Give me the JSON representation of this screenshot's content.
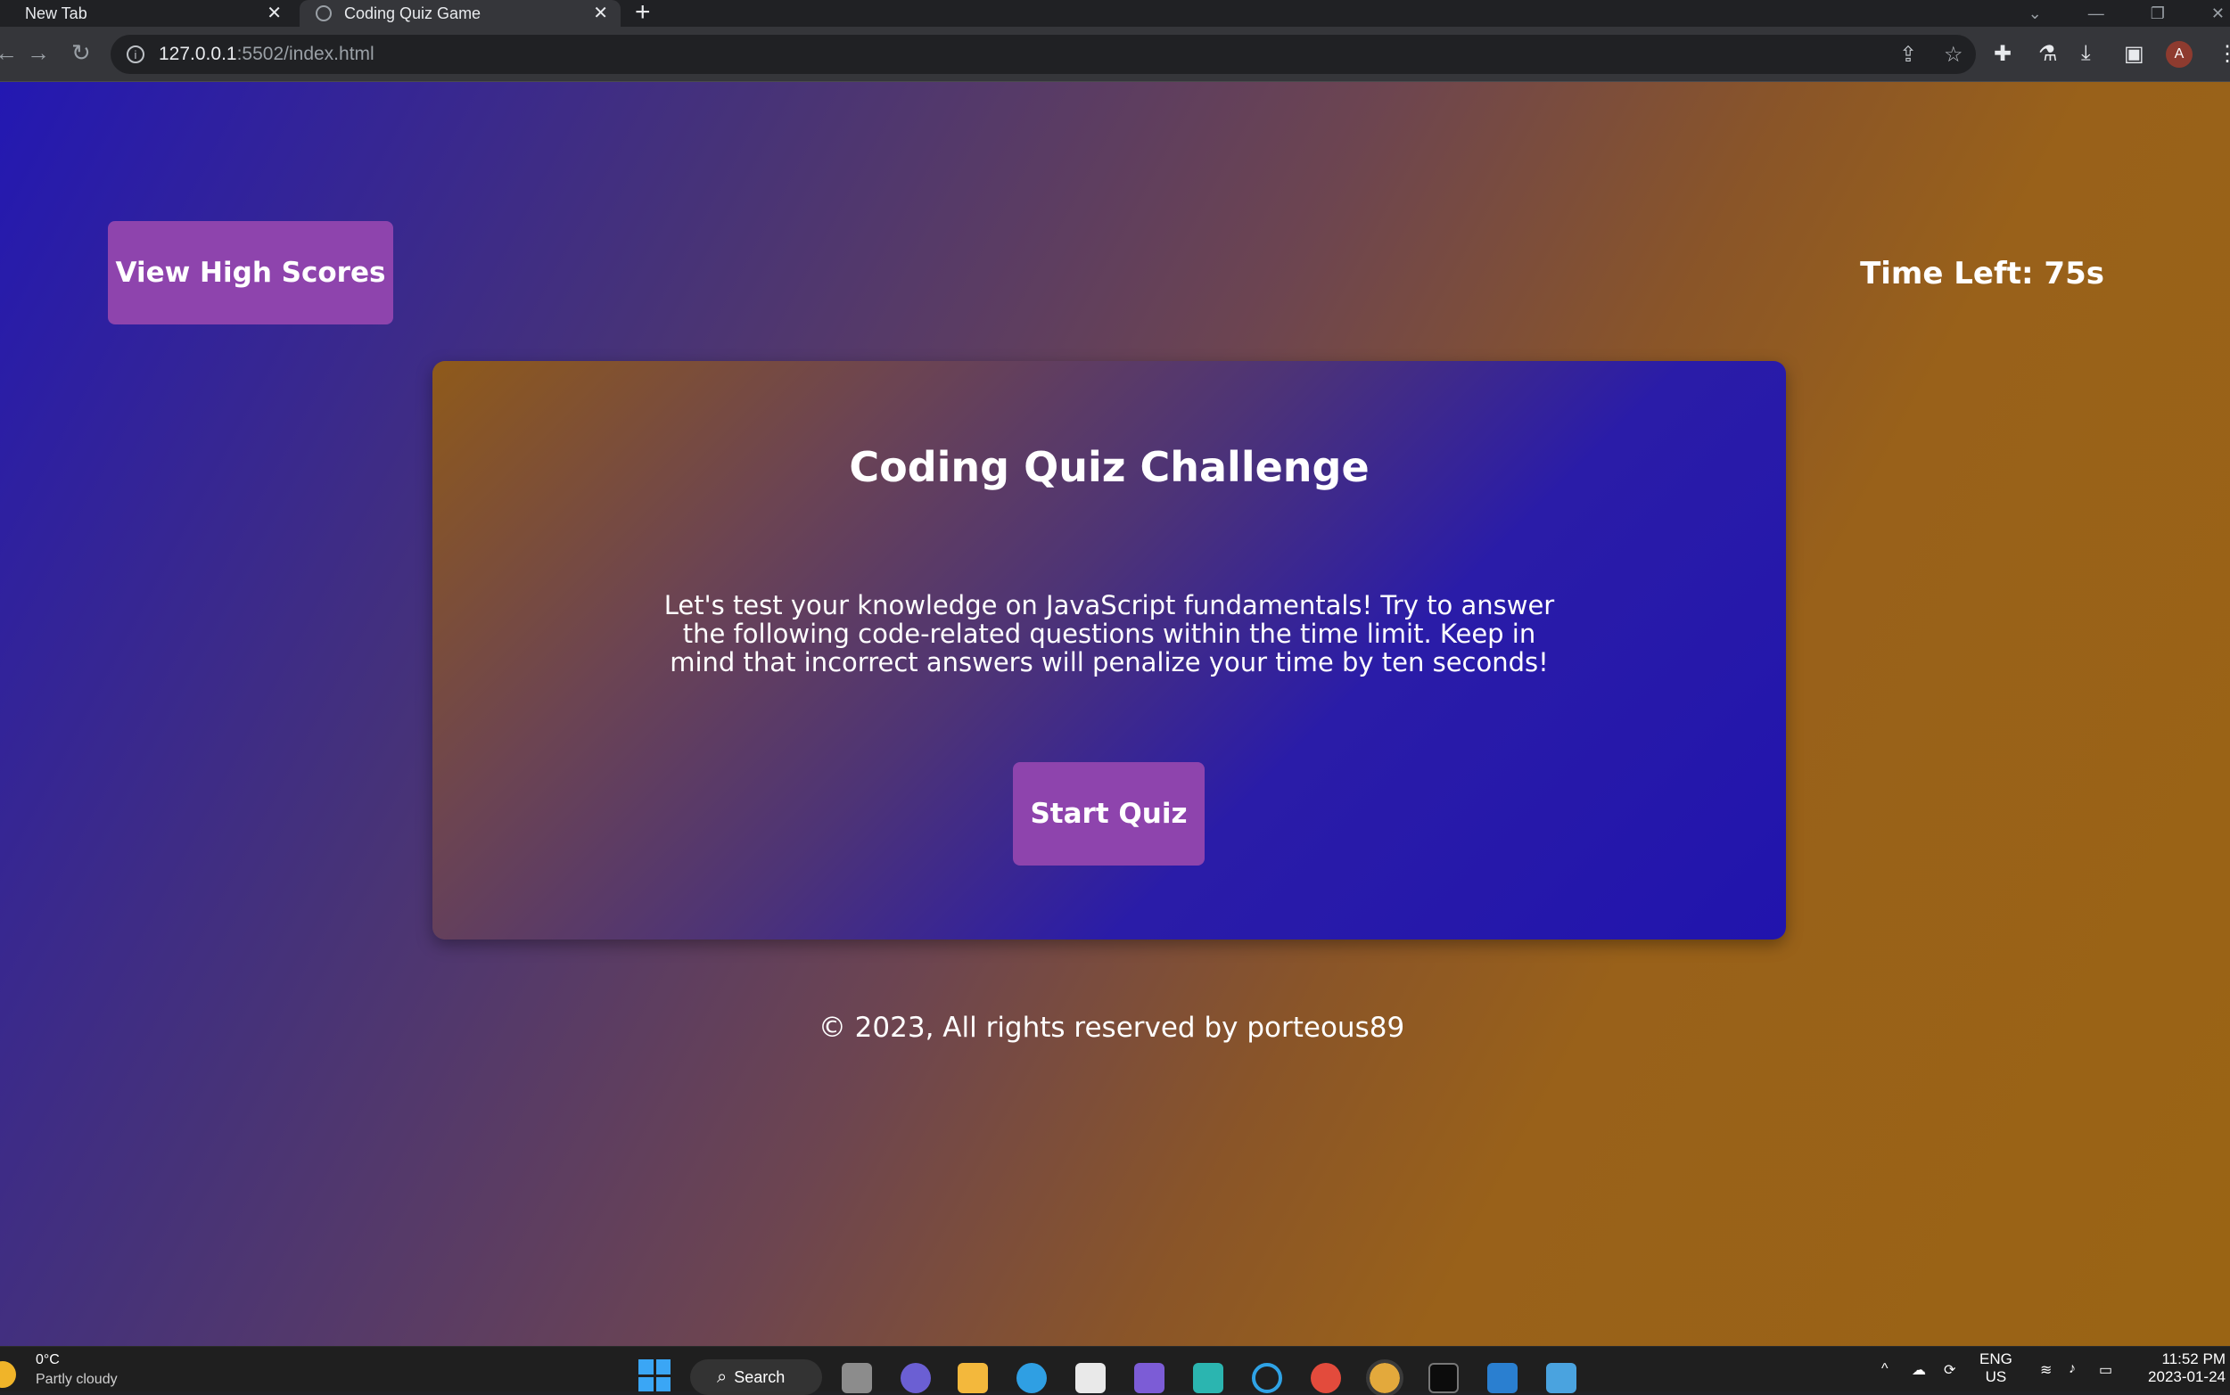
{
  "browser": {
    "tabs": [
      {
        "label": "New Tab",
        "close": "✕"
      },
      {
        "label": "Coding Quiz Game",
        "close": "✕"
      }
    ],
    "new_tab": "+",
    "url_host": "127.0.0.1",
    "url_path": ":5502/index.html",
    "profile_initial": "A"
  },
  "page": {
    "high_scores_label": "View High Scores",
    "timer_text": "Time Left: 75s",
    "title": "Coding Quiz Challenge",
    "description": "Let's test your knowledge on JavaScript fundamentals! Try to answer the following code-related questions within the time limit. Keep in mind that incorrect answers will penalize your time by ten seconds!",
    "start_label": "Start Quiz",
    "footer": "© 2023, All rights reserved by porteous89",
    "colors": {
      "button": "#8e44ad",
      "text": "#ffffff"
    }
  },
  "taskbar": {
    "temperature": "0°C",
    "weather_condition": "Partly cloudy",
    "search_label": "Search",
    "language_line1": "ENG",
    "language_line2": "US",
    "time": "11:52 PM",
    "date": "2023-01-24"
  }
}
